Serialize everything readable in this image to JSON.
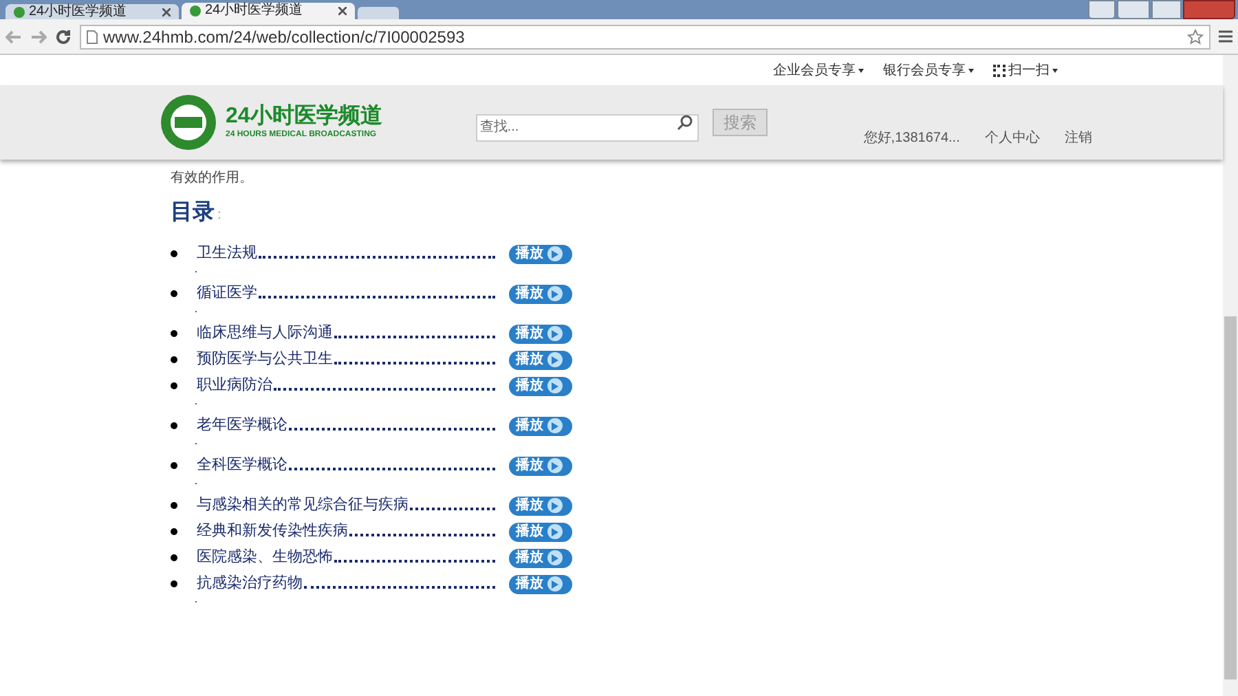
{
  "browser": {
    "tabs": [
      {
        "label": "24小时医学频道",
        "selected": false
      },
      {
        "label": "24小时医学频道",
        "selected": true
      }
    ],
    "url": "www.24hmb.com/24/web/collection/c/7I00002593"
  },
  "top_links": [
    "企业会员专享",
    "银行会员专享",
    "扫一扫"
  ],
  "header": {
    "logo_title": "24小时医学频道",
    "logo_subtitle": "24 HOURS MEDICAL BROADCASTING",
    "search": {
      "placeholder": "查找..."
    },
    "search_button": "搜索",
    "user": "您好,1381674...",
    "links": [
      "个人中心",
      "注销"
    ]
  },
  "intro_tail": "有效的作用。",
  "toc": {
    "title": "目录",
    "colon": ":",
    "items": [
      {
        "label": "卫生法规",
        "play": "播放",
        "after": "·"
      },
      {
        "label": "循证医学",
        "play": "播放",
        "after": "·"
      },
      {
        "label": "临床思维与人际沟通",
        "play": "播放"
      },
      {
        "label": "预防医学与公共卫生",
        "play": "播放"
      },
      {
        "label": "职业病防治",
        "play": "播放",
        "after": "·"
      },
      {
        "label": "老年医学概论",
        "play": "播放",
        "after": "·"
      },
      {
        "label": "全科医学概论",
        "play": "播放",
        "after": "·"
      },
      {
        "label": "与感染相关的常见综合征与疾病",
        "play": "播放"
      },
      {
        "label": "经典和新发传染性疾病",
        "play": "播放"
      },
      {
        "label": "医院感染、生物恐怖",
        "play": "播放"
      },
      {
        "label": "抗感染治疗药物",
        "play": "播放",
        "after": "·"
      }
    ]
  }
}
